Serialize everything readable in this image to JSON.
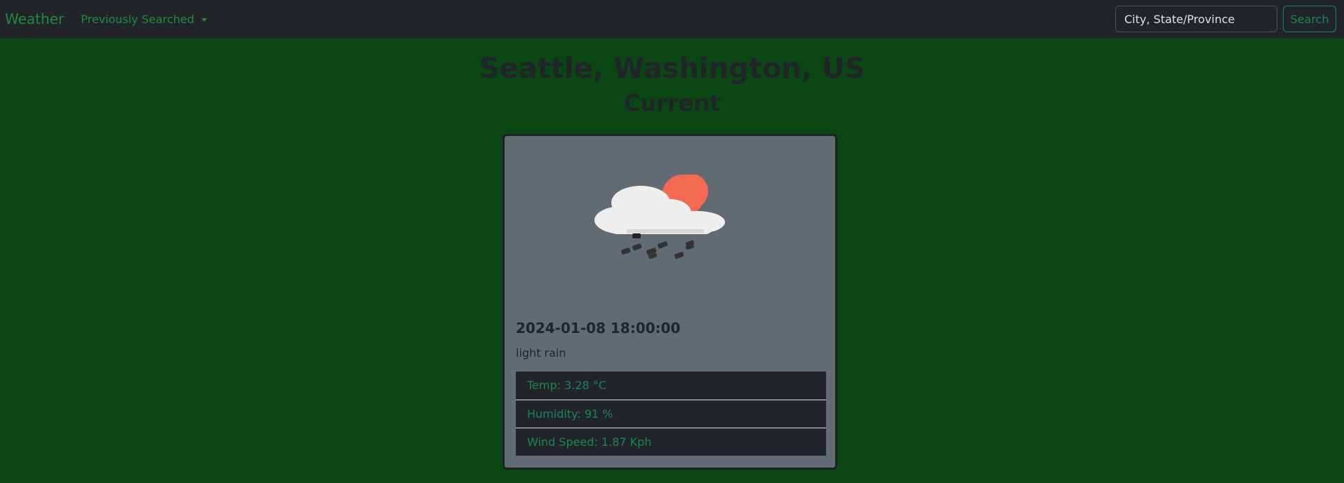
{
  "navbar": {
    "brand": "Weather",
    "dropdown_label": "Previously Searched",
    "search": {
      "placeholder": "City, State/Province",
      "value": ""
    },
    "search_button_label": "Search"
  },
  "location": {
    "title": "Seattle, Washington, US"
  },
  "current": {
    "heading": "Current",
    "icon": "cloud-sun-rain-icon",
    "datetime": "2024-01-08 18:00:00",
    "description": "light rain",
    "temp": "Temp: 3.28 °C",
    "humidity": "Humidity: 91 %",
    "wind": "Wind Speed: 1.87 Kph"
  },
  "colors": {
    "page_background": "#0b4714",
    "navbar_background": "#212529",
    "accent_green": "#198754",
    "card_background": "#626b73",
    "sun": "#f36952"
  }
}
